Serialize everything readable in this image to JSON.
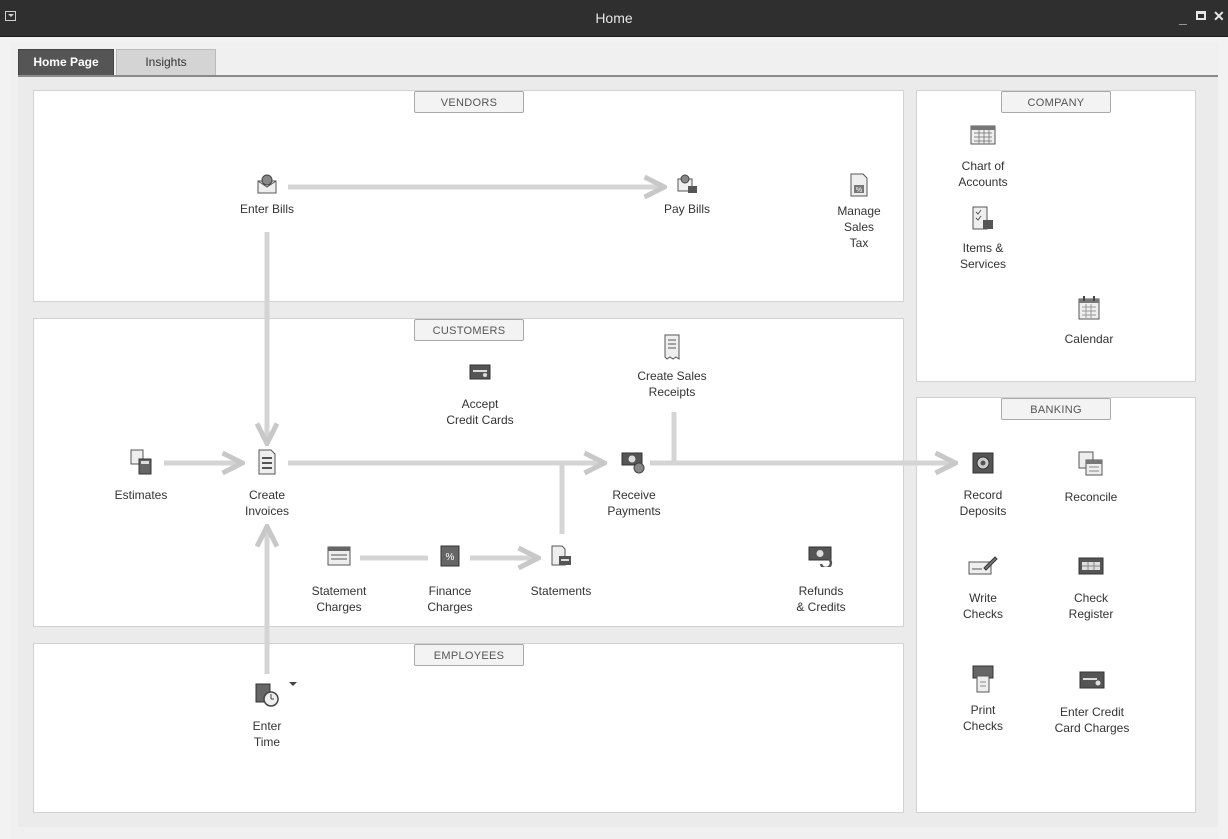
{
  "window": {
    "title": "Home"
  },
  "tabs": [
    {
      "label": "Home Page"
    },
    {
      "label": "Insights"
    }
  ],
  "sections": {
    "vendors": "VENDORS",
    "customers": "CUSTOMERS",
    "employees": "EMPLOYEES",
    "company": "COMPANY",
    "banking": "BANKING"
  },
  "vendors": {
    "enter_bills": [
      "Enter Bills"
    ],
    "pay_bills": [
      "Pay Bills"
    ],
    "manage_sales_tax": [
      "Manage",
      "Sales",
      "Tax"
    ]
  },
  "customers": {
    "accept_credit_cards": [
      "Accept",
      "Credit Cards"
    ],
    "create_sales_receipts": [
      "Create Sales",
      "Receipts"
    ],
    "estimates": [
      "Estimates"
    ],
    "create_invoices": [
      "Create",
      "Invoices"
    ],
    "receive_payments": [
      "Receive",
      "Payments"
    ],
    "statement_charges": [
      "Statement",
      "Charges"
    ],
    "finance_charges": [
      "Finance",
      "Charges"
    ],
    "statements": [
      "Statements"
    ],
    "refunds_credits": [
      "Refunds",
      "& Credits"
    ]
  },
  "employees": {
    "enter_time": [
      "Enter",
      "Time"
    ]
  },
  "company": {
    "chart_of_accounts": [
      "Chart of",
      "Accounts"
    ],
    "items_services": [
      "Items &",
      "Services"
    ],
    "calendar": [
      "Calendar"
    ]
  },
  "banking": {
    "record_deposits": [
      "Record",
      "Deposits"
    ],
    "reconcile": [
      "Reconcile"
    ],
    "write_checks": [
      "Write",
      "Checks"
    ],
    "check_register": [
      "Check",
      "Register"
    ],
    "print_checks": [
      "Print",
      "Checks"
    ],
    "enter_credit_card_charges": [
      "Enter Credit",
      "Card Charges"
    ]
  }
}
